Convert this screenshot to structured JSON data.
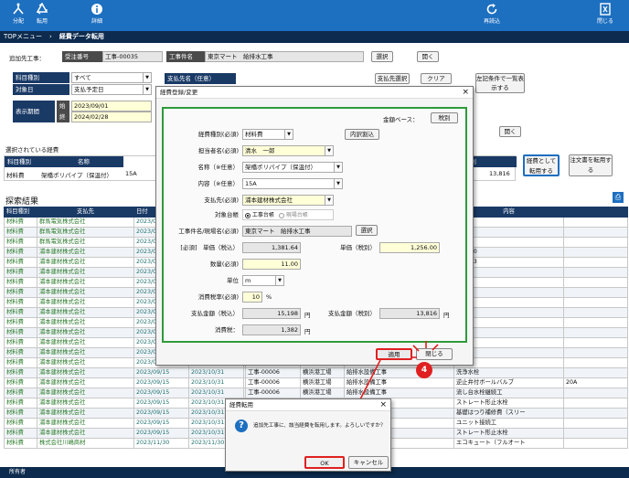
{
  "toolbar": {
    "distribute": "分配",
    "repost": "転用",
    "detail": "詳細",
    "reload": "再読込",
    "close": "閉じる"
  },
  "breadcrumb": {
    "menu": "TOPメニュー",
    "current": "経費データ転用"
  },
  "target": {
    "label": "追加先工事：",
    "order_no_label": "受注番号",
    "order_no": "工事-00035",
    "work_name_label": "工事件名",
    "work_name": "東京マート　給排水工事",
    "select_btn": "選択",
    "open_btn": "開く"
  },
  "filters": {
    "category_label": "科目種別",
    "category_value": "すべて",
    "date_label": "対象日",
    "date_value": "支払予定日",
    "period_label": "表示期間",
    "start_label": "始",
    "start_value": "2023/09/01",
    "end_label": "終",
    "end_value": "2024/02/28",
    "payee_label": "支払先名（任意）",
    "payee_select_btn": "支払先選択",
    "clear_btn": "クリア",
    "search_btn": "左記条件で一覧表示する"
  },
  "selected": {
    "title": "選択されている経費",
    "headers": [
      "科目種別",
      "名称"
    ],
    "row": {
      "category": "材料費",
      "name": "架橋ポリパイプ（保温付）",
      "size": "15A",
      "amount": "13,816",
      "unit_col": "税別"
    },
    "open_btn": "開く",
    "repost_btn": "経費として転用する",
    "order_repost_btn": "注文書を転用する"
  },
  "results": {
    "title": "探索結果",
    "headers": [
      "科目種別",
      "支払先",
      "日付",
      "",
      "",
      "",
      "",
      "称",
      "内容"
    ],
    "rows": [
      [
        "材料費",
        "群馬電気株式会社",
        "2023/09",
        "",
        "",
        "",
        "",
        "",
        ""
      ],
      [
        "材料費",
        "群馬電気株式会社",
        "2023/09",
        "",
        "",
        "",
        "",
        "",
        ""
      ],
      [
        "材料費",
        "群馬電気株式会社",
        "2023/09",
        "",
        "",
        "",
        "",
        "",
        ""
      ],
      [
        "材料費",
        "浦本建材株式会社",
        "2023/09",
        "",
        "",
        "",
        "",
        "ポールパイプ",
        "HIVP20"
      ],
      [
        "材料費",
        "浦本建材株式会社",
        "2023/09",
        "",
        "",
        "",
        "",
        "ポールパイプ",
        "HIVP13"
      ],
      [
        "材料費",
        "浦本建材株式会社",
        "2023/09",
        "",
        "",
        "",
        "",
        "プ（保温付）",
        "20A"
      ],
      [
        "材料費",
        "浦本建材株式会社",
        "2023/09",
        "",
        "",
        "",
        "",
        "プ（保温付）",
        "15A"
      ],
      [
        "材料費",
        "浦本建材株式会社",
        "2023/09",
        "",
        "",
        "",
        "",
        "材",
        ""
      ],
      [
        "材料費",
        "浦本建材株式会社",
        "2023/09",
        "",
        "",
        "",
        "",
        "",
        ""
      ],
      [
        "材料費",
        "浦本建材株式会社",
        "2023/09",
        "",
        "",
        "",
        "",
        "材",
        ""
      ],
      [
        "材料費",
        "浦本建材株式会社",
        "2023/09",
        "",
        "",
        "",
        "",
        "材",
        ""
      ],
      [
        "材料費",
        "浦本建材株式会社",
        "2023/09",
        "",
        "",
        "",
        "",
        "材",
        ""
      ],
      [
        "材料費",
        "浦本建材株式会社",
        "2023/09",
        "",
        "",
        "",
        "",
        "材",
        ""
      ],
      [
        "材料費",
        "浦本建材株式会社",
        "2023/09",
        "",
        "",
        "",
        "",
        "材",
        ""
      ],
      [
        "材料費",
        "浦本建材株式会社",
        "2023/09",
        "",
        "",
        "",
        "",
        "材",
        ""
      ],
      [
        "材料費",
        "浦本建材株式会社",
        "2023/09/15",
        "2023/10/31",
        "",
        "工事-00006",
        "横浜港工場",
        "給排水設備工事",
        "洗浄水栓"
      ],
      [
        "材料費",
        "浦本建材株式会社",
        "2023/09/15",
        "2023/10/31",
        "",
        "工事-00006",
        "横浜港工場",
        "給排水設備工事",
        "逆止弁付ボールバルブ"
      ],
      [
        "材料費",
        "浦本建材株式会社",
        "2023/09/15",
        "2023/10/31",
        "",
        "工事-00006",
        "横浜港工場",
        "給排水設備工事",
        "流し台水栓継続工"
      ],
      [
        "材料費",
        "浦本建材株式会社",
        "2023/09/15",
        "2023/10/31",
        "",
        "工事-00006",
        "横浜港工場",
        "給排水設備工事",
        "ストレート形止水栓"
      ],
      [
        "材料費",
        "浦本建材株式会社",
        "2023/09/15",
        "2023/10/31",
        "",
        "工事-00006",
        "横浜港工場",
        "給排水設備工事",
        "基礎はつり補修費（スリー"
      ],
      [
        "材料費",
        "浦本建材株式会社",
        "2023/09/15",
        "2023/10/31",
        "",
        "工事-00006",
        "横浜港工場",
        "給排水設備工事",
        "ユニット接続工"
      ],
      [
        "材料費",
        "浦本建材株式会社",
        "2023/09/15",
        "2023/10/31",
        "",
        "工事-00006",
        "横浜港工場",
        "給排水設備工事",
        "ストレート形止水栓"
      ],
      [
        "材料費",
        "株式会社川嶋商材",
        "2023/11/30",
        "2023/11/30",
        "",
        "工事-00006",
        "横浜港工場",
        "給排水設備工事",
        "エコキュート（フルオート"
      ]
    ],
    "extra_col": [
      "",
      "",
      "",
      "",
      "",
      "",
      "",
      "",
      "",
      "",
      "",
      "",
      "",
      "",
      "",
      "",
      "20A",
      "",
      "",
      "",
      "",
      "",
      ""
    ]
  },
  "status_bar": "所有者",
  "edit_dialog": {
    "title": "経費登録/変更",
    "amount_base_label": "金額ベース：",
    "amount_base_btn": "税別",
    "internal_btn": "内訳割込",
    "fields": {
      "category_label": "経費種別(必須)",
      "category_value": "材料費",
      "person_label": "担当者名(必須)",
      "person_value": "清水　一郎",
      "name_label": "名称（※任意）",
      "name_value": "架橋ポリパイプ（保温付）",
      "content_label": "内容（※任意）",
      "content_value": "15A",
      "payee_label": "支払先(必須)",
      "payee_value": "浦本建材株式会社",
      "target_label": "対象台帳",
      "radio_work": "工事台帳",
      "radio_site": "現場台帳",
      "work_label": "工事件名/現場名(必須)",
      "work_value": "東京マート　給排水工事",
      "work_select_btn": "選択",
      "price_label": "[必須]　単価（税込）",
      "price_value": "1,381.64",
      "price_net_label": "単価（税別）",
      "price_net_value": "1,256.00",
      "qty_label": "数量(必須)",
      "qty_value": "11.00",
      "unit_label": "単位",
      "unit_value": "m",
      "tax_label": "消費税率(必須)",
      "tax_value": "10",
      "tax_unit": "%",
      "total_label": "支払金額（税込）",
      "total_value": "15,198",
      "total_unit": "円",
      "total_net_label": "支払金額（税別）",
      "total_net_value": "13,816",
      "total_net_unit": "円",
      "consumption_label": "消費税：",
      "consumption_value": "1,382",
      "consumption_unit": "円"
    },
    "apply_btn": "適用",
    "cancel_btn": "閉じる",
    "step_badge": "4"
  },
  "confirm_dialog": {
    "title": "経費転用",
    "message": "追加先工事に、該当経費を転用します。よろしいですか？",
    "ok_btn": "OK",
    "cancel_btn": "キャンセル"
  },
  "colors": {
    "topbar": "#1d6fc0",
    "breadcrumb": "#0c2b4e",
    "highlight": "#e02020",
    "form_border": "#2e9a3a"
  }
}
